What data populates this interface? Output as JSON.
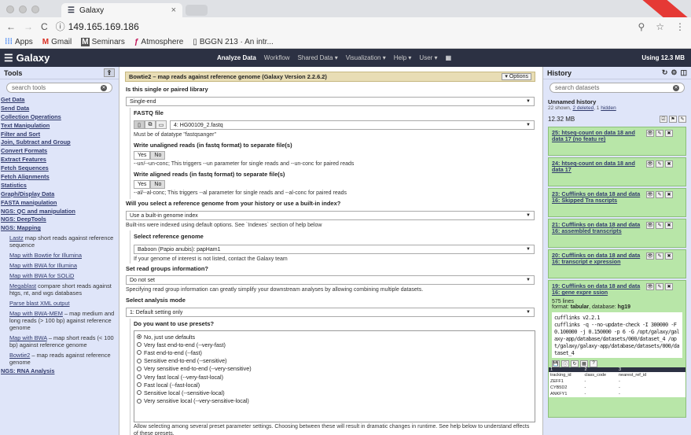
{
  "browser": {
    "tab_title": "Galaxy",
    "url": "149.165.169.186",
    "bookmarks": [
      "Apps",
      "Gmail",
      "Seminars",
      "Atmosphere",
      "BGGN 213 · An intr..."
    ]
  },
  "galaxy": {
    "brand": "Galaxy",
    "nav": [
      "Analyze Data",
      "Workflow",
      "Shared Data ▾",
      "Visualization ▾",
      "Help ▾",
      "User ▾"
    ],
    "usage": "Using 12.3 MB"
  },
  "tools": {
    "title": "Tools",
    "search_placeholder": "search tools",
    "sections": [
      "Get Data",
      "Send Data",
      "Collection Operations",
      "Text Manipulation",
      "Filter and Sort",
      "Join, Subtract and Group",
      "Convert Formats",
      "Extract Features",
      "Fetch Sequences",
      "Fetch Alignments",
      "Statistics",
      "Graph/Display Data",
      "FASTA manipulation",
      "NGS: QC and manipulation",
      "NGS: DeepTools",
      "NGS: Mapping"
    ],
    "mapping_tools": [
      {
        "name": "Lastz",
        "desc": " map short reads against reference sequence"
      },
      {
        "name": "Map with Bowtie for Illumina",
        "desc": ""
      },
      {
        "name": "Map with BWA for Illumina",
        "desc": ""
      },
      {
        "name": "Map with BWA for SOLiD",
        "desc": ""
      },
      {
        "name": "Megablast",
        "desc": " compare short reads against htgs, nt, and wgs databases"
      },
      {
        "name": "Parse blast XML output",
        "desc": ""
      },
      {
        "name": "Map with BWA-MEM",
        "desc": " – map medium and long reads (> 100 bp) against reference genome"
      },
      {
        "name": "Map with BWA",
        "desc": " – map short reads (< 100 bp) against reference genome"
      },
      {
        "name": "Bowtie2",
        "desc": " – map reads against reference genome"
      }
    ],
    "last_section": "NGS: RNA Analysis"
  },
  "form": {
    "title": "Bowtie2 – map reads against reference genome (Galaxy Version 2.2.6.2)",
    "options": "▾ Options",
    "q1": "Is this single or paired library",
    "q1_val": "Single-end",
    "fastq_label": "FASTQ file",
    "fastq_val": "4: HG00109_2.fastq",
    "fastq_help": "Must be of datatype \"fastqsanger\"",
    "unal_label": "Write unaligned reads (in fastq format) to separate file(s)",
    "yes": "Yes",
    "no": "No",
    "unal_help": "--un/--un-conc; This triggers --un parameter for single reads and --un-conc for paired reads",
    "al_label": "Write aligned reads (in fastq format) to separate file(s)",
    "al_help": "--al/--al-conc; This triggers --al parameter for single reads and --al-conc for paired reads",
    "q2": "Will you select a reference genome from your history or use a built-in index?",
    "q2_val": "Use a built-in genome index",
    "q2_help": "Built-ins were indexed using default options. See `Indexes` section of help below",
    "ref_label": "Select reference genome",
    "ref_val": "Baboon (Papio anubis): papHam1",
    "ref_help": "If your genome of interest is not listed, contact the Galaxy team",
    "rg_label": "Set read groups information?",
    "rg_val": "Do not set",
    "rg_help": "Specifying read group information can greatly simplify your downstream analyses by allowing combining multiple datasets.",
    "mode_label": "Select analysis mode",
    "mode_val": "1: Default setting only",
    "preset_label": "Do you want to use presets?",
    "presets": [
      "No, just use defaults",
      "Very fast end-to-end (--very-fast)",
      "Fast end-to-end (--fast)",
      "Sensitive end-to-end (--sensitive)",
      "Very sensitive end-to-end (--very-sensitive)",
      "Very fast local (--very-fast-local)",
      "Fast local (--fast-local)",
      "Sensitive local (--sensitive-local)",
      "Very sensitive local (--very-sensitive-local)"
    ],
    "preset_help": "Allow selecting among several preset parameter settings. Choosing between these will result in dramatic changes in runtime. See help below to understand effects of these presets."
  },
  "history": {
    "title": "History",
    "search_placeholder": "search datasets",
    "name": "Unnamed history",
    "meta_shown": "22 shown, ",
    "meta_deleted": "2 deleted",
    "meta_sep": ", 1 ",
    "meta_hidden": "hidden",
    "size": "12.32 MB",
    "datasets": [
      "25: htseq-count on data 18 and data 17 (no featu re)",
      "24: htseq-count on data 18 and data 17",
      "23: Cufflinks on data 18 and data 16: Skipped Tra nscripts",
      "21: Cufflinks on data 18 and data 16: assembled transcripts",
      "20: Cufflinks on data 18 and data 16: transcript e xpression"
    ],
    "expanded": {
      "name": "19: Cufflinks on data 18 and data 16: gene expre ssion",
      "lines": "575 lines",
      "format_label": "format: ",
      "format": "tabular",
      "db_label": ", database: ",
      "db": "hg19",
      "cmd": "cufflinks v2.2.1\ncufflinks -q --no-update-check -I 300000 -F 0.100000 -j 0.150000 -p 6 -G /opt/galaxy/galaxy-app/database/datasets/000/dataset_4 /opt/galaxy/galaxy-app/database/datasets/000/dataset_4",
      "peek_cols": [
        "1",
        "2",
        "3",
        ""
      ],
      "peek_head": [
        "tracking_id",
        "class_code",
        "nearest_ref_id",
        ""
      ],
      "peek_rows": [
        [
          "ZEFF1",
          "-",
          "-",
          ""
        ],
        [
          "CYB5D2",
          "-",
          "-",
          ""
        ],
        [
          "ANKFY1",
          "-",
          "-",
          ""
        ]
      ]
    }
  }
}
